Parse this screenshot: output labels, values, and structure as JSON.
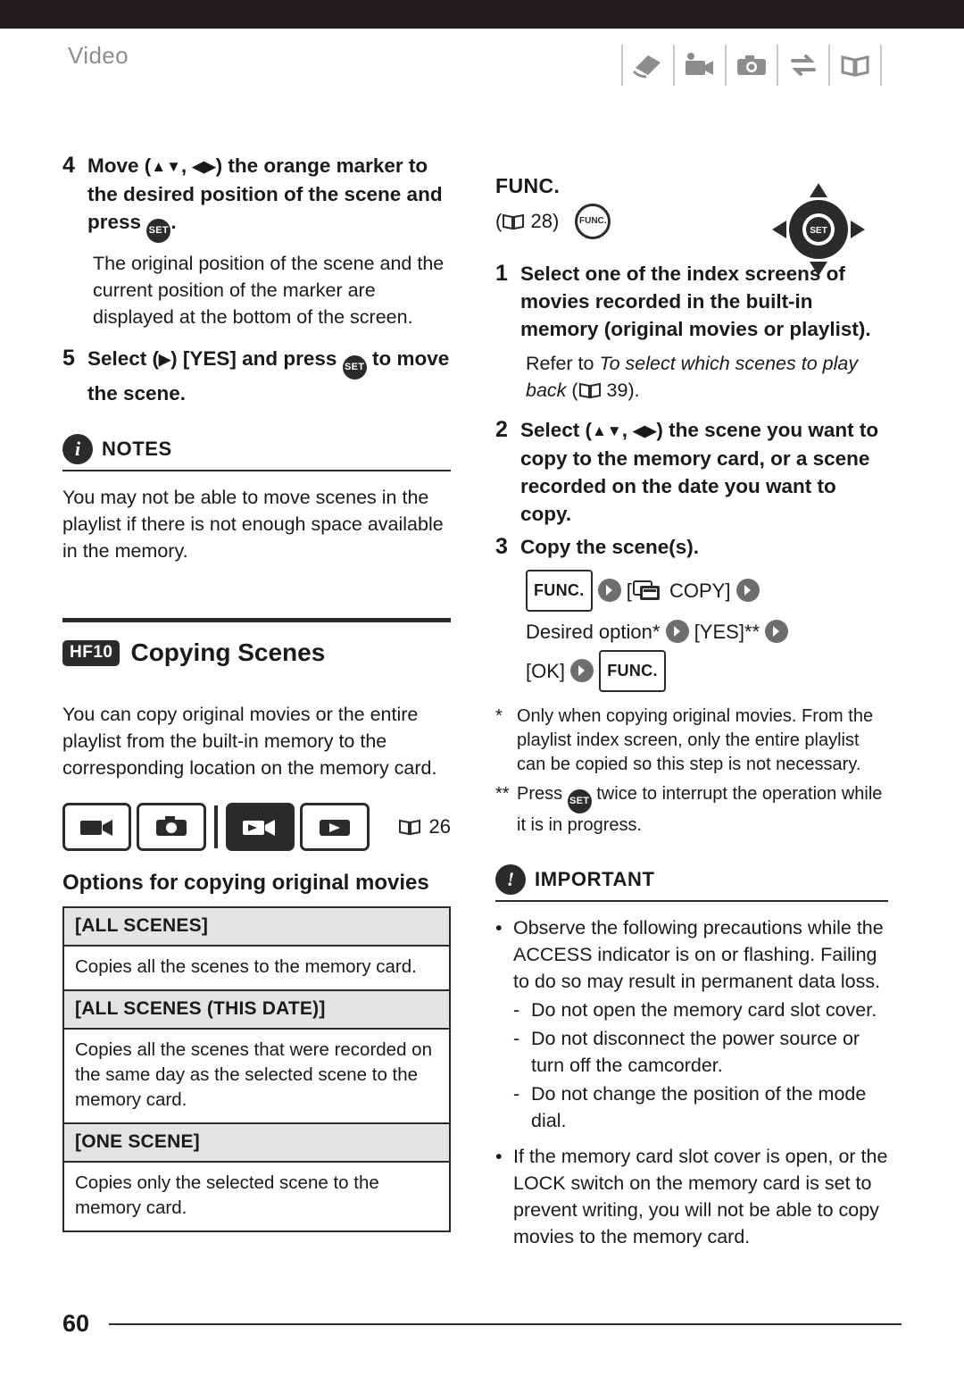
{
  "header": {
    "title": "Video",
    "icons": [
      "hand-card-icon",
      "camcorder-icon",
      "camera-icon",
      "transfer-icon",
      "book-icon"
    ]
  },
  "left_column": {
    "step4": {
      "num": "4",
      "text_before": "Move (",
      "text_mid": ", ",
      "text_after": ") the orange marker to the desired position of the scene and press",
      "trailing": "."
    },
    "step4_body": "The original position of the scene and the current position of the marker are displayed at the bottom of the screen.",
    "step5": {
      "num": "5",
      "text_before": "Select (",
      "text_mid": ") [YES] and press",
      "text_after": "to move the scene."
    },
    "notes": {
      "label": "NOTES",
      "icon": "info-icon",
      "body": "You may not be able to move scenes in the playlist if there is not enough space available in the memory."
    },
    "section": {
      "badge": "HF10",
      "title": "Copying Scenes",
      "intro": "You can copy original movies or the entire playlist from the built-in memory to the corresponding location on the memory card.",
      "page_ref": "26",
      "modes": [
        "movie-record-icon",
        "photo-record-icon",
        "movie-play-icon",
        "photo-play-icon"
      ],
      "selected_mode_index": 2,
      "subhead": "Options for copying original movies",
      "options": [
        {
          "name": "[ALL SCENES]",
          "desc": "Copies all the scenes to the memory card."
        },
        {
          "name": "[ALL SCENES (THIS DATE)]",
          "desc": "Copies all the scenes that were recorded on the same day as the selected scene to the memory card."
        },
        {
          "name": "[ONE SCENE]",
          "desc": "Copies only the selected scene to the memory card."
        }
      ]
    }
  },
  "right_column": {
    "func_label": "FUNC.",
    "func_page_ref": "28",
    "func_button_label": "FUNC.",
    "joystick_label": "SET",
    "step1": {
      "num": "1",
      "text": "Select one of the index screens of movies recorded in the built-in memory (original movies or playlist)."
    },
    "step1_body_prefix": "Refer to ",
    "step1_body_italic": "To select which scenes to play back",
    "step1_body_ref": "39",
    "step1_body_suffix": ").",
    "step2": {
      "num": "2",
      "text_before": "Select (",
      "text_mid": ", ",
      "text_after": ") the scene you want to copy to the memory card, or a scene recorded on the date you want to copy."
    },
    "step3": {
      "num": "3",
      "text": "Copy the scene(s)."
    },
    "sequence": {
      "func1": "FUNC.",
      "copy_label": "COPY",
      "copy_bracket_open": "[",
      "copy_bracket_close": "]",
      "desired_option": "Desired option*",
      "yes": "[YES]**",
      "ok": "[OK]",
      "func2": "FUNC."
    },
    "footnote1_mark": "*",
    "footnote1": "Only when copying original movies. From the playlist index screen, only the entire playlist can be copied so this step is not necessary.",
    "footnote2_mark": "**",
    "footnote2_before": "Press",
    "footnote2_after": "twice to interrupt the operation while it is in progress.",
    "important": {
      "label": "IMPORTANT",
      "icon": "exclamation-icon",
      "bullet1": "Observe the following precautions while the ACCESS indicator is on or flashing. Failing to do so may result in permanent data loss.",
      "dash1": "Do not open the memory card slot cover.",
      "dash2": "Do not disconnect the power source or turn off the camcorder.",
      "dash3": "Do not change the position of the mode dial.",
      "bullet2": "If the memory card slot cover is open, or the LOCK switch on the memory card is set to prevent writing, you will not be able to copy movies to the memory card."
    }
  },
  "footer": {
    "page_number": "60"
  }
}
